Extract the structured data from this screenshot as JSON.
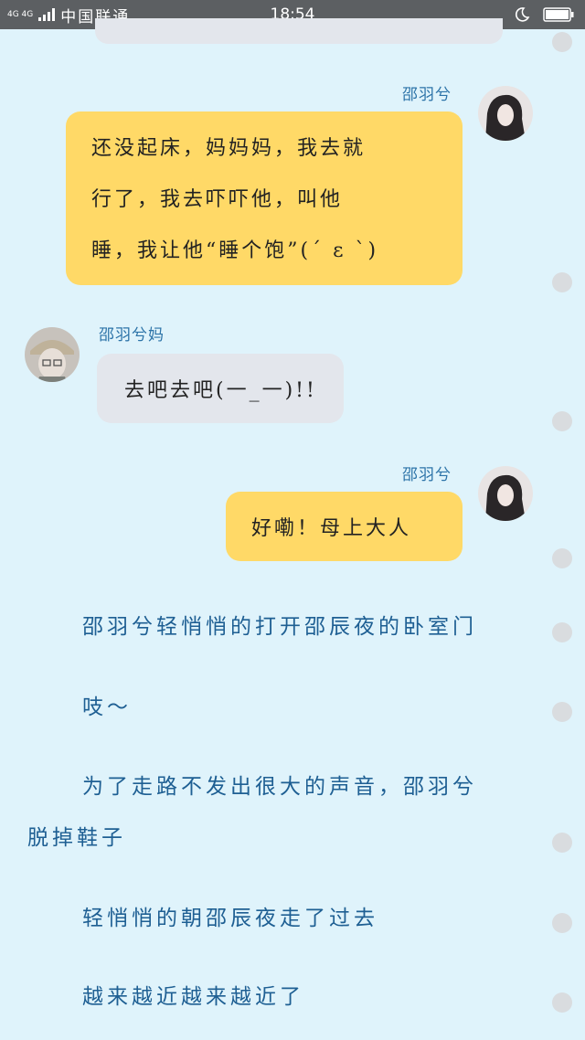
{
  "status_bar": {
    "network": "4G 4G",
    "carrier": "中国联通",
    "time": "18:54"
  },
  "messages": [
    {
      "sender": "邵羽兮",
      "side": "right",
      "lines": [
        "还没起床，妈妈妈，我去就",
        "行了，我去吓吓他，叫他",
        "睡，我让他“睡个饱”(ˊ ε ˋ)"
      ]
    },
    {
      "sender": "邵羽兮妈",
      "side": "left",
      "lines": [
        "去吧去吧(一_一)!!"
      ]
    },
    {
      "sender": "邵羽兮",
      "side": "right",
      "lines": [
        "好嘞！母上大人"
      ]
    }
  ],
  "narration": [
    "邵羽兮轻悄悄的打开邵辰夜的卧室门",
    "吱～",
    "为了走路不发出很大的声音，邵羽兮",
    "脱掉鞋子",
    "轻悄悄的朝邵辰夜走了过去",
    "越来越近越来越近了"
  ],
  "colors": {
    "background": "#dff3fb",
    "status_bar": "#5c5f62",
    "bubble_self": "#ffd967",
    "bubble_other": "#e3e6ec",
    "sender_name": "#2c73a8",
    "narration": "#1e5f93"
  },
  "icons": [
    "signal-icon",
    "moon-icon",
    "battery-icon"
  ]
}
